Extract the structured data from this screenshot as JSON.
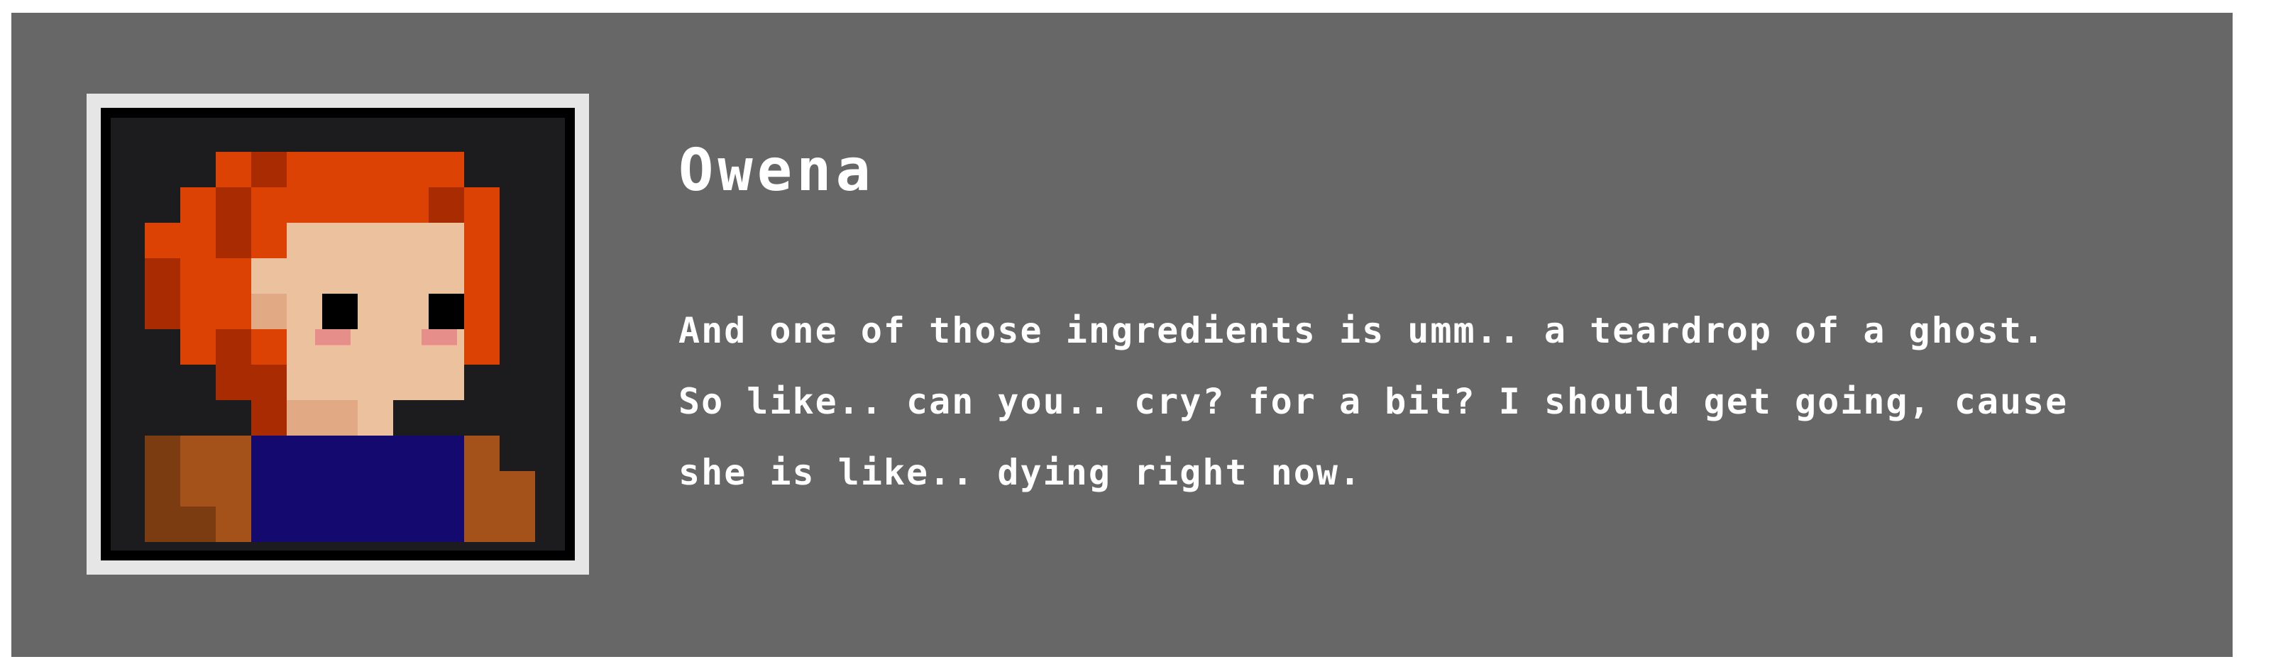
{
  "dialog": {
    "speaker_name": "Owena",
    "lines": [
      "And one of those ingredients is umm.. a teardrop of a ghost.",
      "So like.. can you.. cry? for a bit? I should get going, cause",
      "she is like.. dying right now."
    ]
  },
  "portrait": {
    "subject": "pixel-art portrait of a red-haired character",
    "colors": {
      "background": "#1c1c1e",
      "hair": "#dc4203",
      "hair_shadow": "#a82b02",
      "skin": "#ebc19e",
      "skin_shadow": "#e1aa84",
      "blush": "#e58e8a",
      "eyes": "#000000",
      "shirt": "#14096f",
      "jacket": "#a5511a",
      "jacket_shadow": "#7a3c10"
    }
  },
  "colors": {
    "panel": "#676767",
    "frame": "#e6e6e6",
    "text": "#ffffff"
  }
}
